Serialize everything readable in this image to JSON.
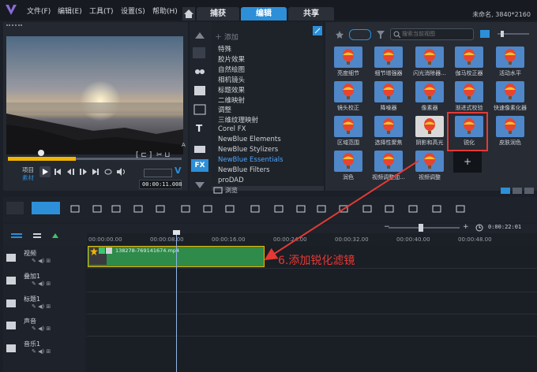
{
  "menu": {
    "file": "文件(F)",
    "edit": "编辑(E)",
    "tools": "工具(T)",
    "settings": "设置(S)",
    "help": "帮助(H)"
  },
  "modes": {
    "capture": "捕获",
    "edit": "编辑",
    "share": "共享"
  },
  "project_info": "未命名, 3840*2160",
  "player": {
    "mode_project": "项目",
    "mode_clip": "素材",
    "timecode": "00:00:11.008"
  },
  "library": {
    "add_label": "添加",
    "browse_label": "浏览",
    "search_placeholder": "搜索当前视图",
    "categories": [
      "特殊",
      "胶片效果",
      "自然绘图",
      "相机镜头",
      "标题效果",
      "二维映射",
      "调整",
      "三维纹理映射",
      "Corel FX",
      "NewBlue Elements",
      "NewBlue Stylizers",
      "NewBlue Essentials",
      "NewBlue Filters",
      "proDAD"
    ],
    "selected_category": "NewBlue Essentials",
    "filters": [
      "亮度细节",
      "细节增强器",
      "闪光消除器...",
      "伽马校正器",
      "活动水平",
      "镜头校正",
      "降噪器",
      "像素器",
      "渐进式校验",
      "快速像素化器",
      "区域范围",
      "选择性聚焦",
      "阴影和高光",
      "锐化",
      "皮肤润色",
      "润色",
      "视频调整加...",
      "视频调整"
    ],
    "selected_filter": "锐化"
  },
  "timeline": {
    "timecode": "0:00:22:01",
    "ruler": [
      "00:00:00.00",
      "00:00:08.00",
      "00:00:16.00",
      "00:00:24.00",
      "00:00:32.00",
      "00:00:40.00",
      "00:00:48.00"
    ],
    "tracks": [
      "视频",
      "叠加1",
      "标题1",
      "声音",
      "音乐1"
    ],
    "clip_name": "138278-769141674.mp4"
  },
  "annotation": "6.添加锐化滤镜",
  "colors": {
    "accent": "#2c8fd8",
    "clip": "#2e8b4a",
    "clip_border": "#f0b400",
    "highlight": "#e53935"
  }
}
